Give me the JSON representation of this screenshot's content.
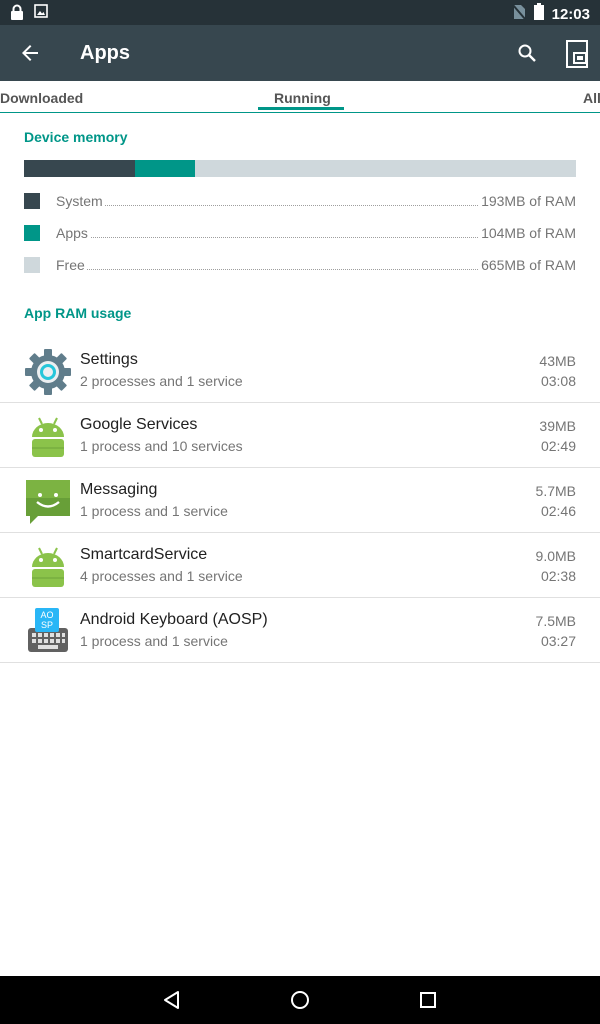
{
  "status_bar": {
    "time": "12:03",
    "icons": [
      "lock-icon",
      "image-icon",
      "no-sim-icon",
      "battery-icon"
    ]
  },
  "app_bar": {
    "title": "Apps",
    "icons": [
      "back-arrow-icon",
      "search-icon",
      "overflow-icon"
    ]
  },
  "tabs": [
    {
      "label": "Downloaded"
    },
    {
      "label": "Running"
    },
    {
      "label": "All"
    }
  ],
  "device_memory": {
    "header": "Device memory",
    "total_mb": 962,
    "rows": [
      {
        "label": "System",
        "value": "193MB of RAM",
        "mb": 193,
        "color": "#37474f"
      },
      {
        "label": "Apps",
        "value": "104MB of RAM",
        "mb": 104,
        "color": "#009688"
      },
      {
        "label": "Free",
        "value": "665MB of RAM",
        "mb": 665,
        "color": "#cfd8dc"
      }
    ]
  },
  "app_ram_usage": {
    "header": "App RAM usage",
    "apps": [
      {
        "name": "Settings",
        "detail": "2 processes and 1 service",
        "memory": "43MB",
        "time": "03:08",
        "icon": "settings-gear-icon"
      },
      {
        "name": "Google Services",
        "detail": "1 process and 10 services",
        "memory": "39MB",
        "time": "02:49",
        "icon": "android-robot-icon"
      },
      {
        "name": "Messaging",
        "detail": "1 process and 1 service",
        "memory": "5.7MB",
        "time": "02:46",
        "icon": "messaging-icon"
      },
      {
        "name": "SmartcardService",
        "detail": "4 processes and 1 service",
        "memory": "9.0MB",
        "time": "02:38",
        "icon": "android-robot-icon"
      },
      {
        "name": "Android Keyboard (AOSP)",
        "detail": "1 process and 1 service",
        "memory": "7.5MB",
        "time": "03:27",
        "icon": "keyboard-aosp-icon"
      }
    ],
    "keyboard_badge": [
      "AO",
      "SP"
    ]
  },
  "colors": {
    "accent": "#009688",
    "app_bar": "#37474f",
    "status_bar": "#263238",
    "android_green": "#8bc34a"
  }
}
